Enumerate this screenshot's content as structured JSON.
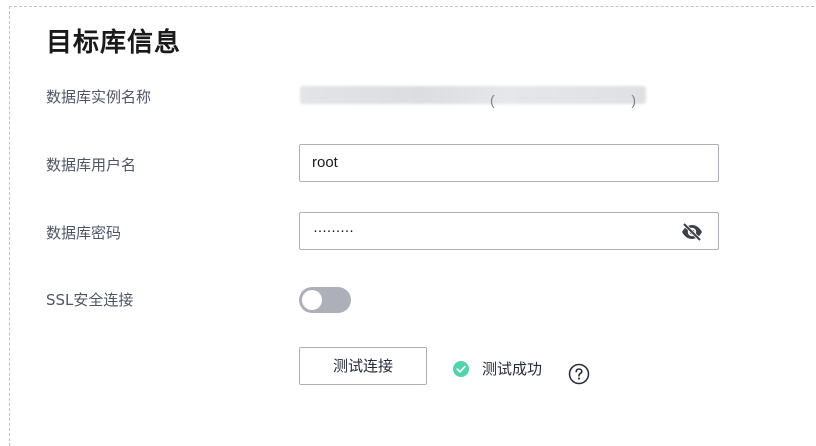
{
  "section": {
    "title": "目标库信息"
  },
  "fields": {
    "instance_name": {
      "label": "数据库实例名称",
      "value_paren_open": "(",
      "value_paren_close": ")"
    },
    "username": {
      "label": "数据库用户名",
      "value": "root"
    },
    "password": {
      "label": "数据库密码",
      "masked_value": "·········",
      "toggle_icon": "eye-off-icon"
    },
    "ssl": {
      "label": "SSL安全连接",
      "enabled": false
    }
  },
  "test_connection": {
    "button_label": "测试连接",
    "status_text": "测试成功",
    "status_icon": "check-circle-icon",
    "status_color": "#50d4ab",
    "help_icon": "question-circle-icon"
  },
  "colors": {
    "border": "#adb0b8",
    "label_text": "#4e5566",
    "switch_off": "#adb0b8"
  }
}
